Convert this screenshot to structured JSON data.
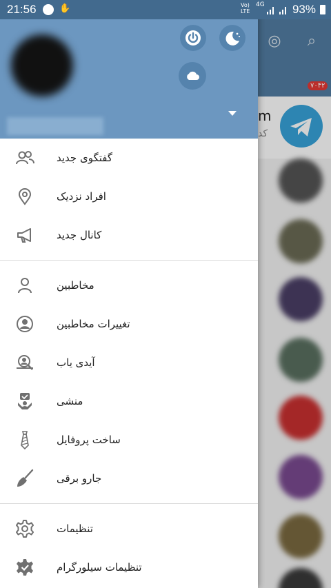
{
  "status_bar": {
    "time": "21:56",
    "battery_percent": "93%",
    "network": "4G",
    "volte": "Vo) LTE"
  },
  "drawer": {
    "header_buttons": [
      "power-icon",
      "night-mode-icon",
      "cloud-icon"
    ],
    "menu_groups": [
      [
        {
          "label": "گفتگوی جدید",
          "icon": "group-icon"
        },
        {
          "label": "افراد نزدیک",
          "icon": "location-pin-icon"
        },
        {
          "label": "کانال جدید",
          "icon": "megaphone-icon"
        }
      ],
      [
        {
          "label": "مخاطبین",
          "icon": "person-icon"
        },
        {
          "label": "تغییرات مخاطبین",
          "icon": "contact-changes-icon"
        },
        {
          "label": "آیدی یاب",
          "icon": "id-finder-icon"
        },
        {
          "label": "منشی",
          "icon": "secretary-icon"
        },
        {
          "label": "ساخت پروفایل",
          "icon": "tie-icon"
        },
        {
          "label": "جارو برقی",
          "icon": "broom-icon"
        }
      ],
      [
        {
          "label": "تنظیمات",
          "icon": "gear-icon"
        },
        {
          "label": "تنظیمات سیلورگرام",
          "icon": "gear-check-icon"
        }
      ]
    ]
  },
  "background_chat": {
    "partial_title": "m",
    "partial_subtitle": "کد",
    "badge": "۷۰۴۲"
  },
  "colors": {
    "header": "#6c97c0",
    "statusbar": "#426a8e",
    "toolbar": "#527da3",
    "icon": "#707070"
  }
}
